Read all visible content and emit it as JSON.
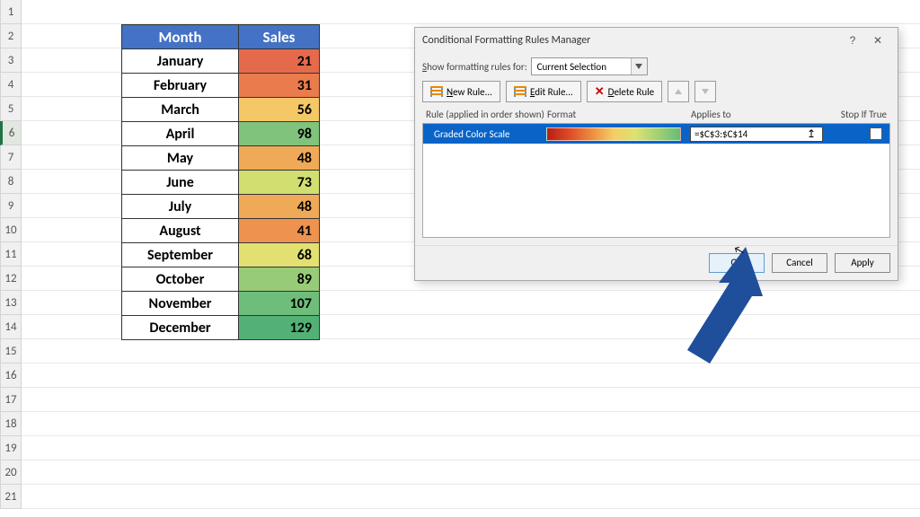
{
  "rows_visible": 21,
  "active_row": 6,
  "table": {
    "headers": {
      "month": "Month",
      "sales": "Sales"
    },
    "data": [
      {
        "month": "January",
        "sales": 21,
        "color": "#e56a4c"
      },
      {
        "month": "February",
        "sales": 31,
        "color": "#ea7b4d"
      },
      {
        "month": "March",
        "sales": 56,
        "color": "#f5c867"
      },
      {
        "month": "April",
        "sales": 98,
        "color": "#7fc37c"
      },
      {
        "month": "May",
        "sales": 48,
        "color": "#f0a956"
      },
      {
        "month": "June",
        "sales": 73,
        "color": "#d2de70"
      },
      {
        "month": "July",
        "sales": 48,
        "color": "#f0a956"
      },
      {
        "month": "August",
        "sales": 41,
        "color": "#ed924f"
      },
      {
        "month": "September",
        "sales": 68,
        "color": "#e3e072"
      },
      {
        "month": "October",
        "sales": 89,
        "color": "#98cb77"
      },
      {
        "month": "November",
        "sales": 107,
        "color": "#6fbd7b"
      },
      {
        "month": "December",
        "sales": 129,
        "color": "#53b176"
      }
    ]
  },
  "dialog": {
    "title": "Conditional Formatting Rules Manager",
    "show_rules_label_pre": "S",
    "show_rules_label_post": "how formatting rules for:",
    "show_rules_value": "Current Selection",
    "buttons": {
      "new_pre": "N",
      "new_post": "ew Rule...",
      "edit_pre": "E",
      "edit_post": "dit Rule...",
      "delete_pre": "D",
      "delete_post": "elete Rule"
    },
    "list_header": {
      "rule": "Rule (applied in order shown)",
      "format": "Format",
      "applies": "Applies to",
      "stop": "Stop If True"
    },
    "rule": {
      "name": "Graded Color Scale",
      "applies_to": "=$C$3:$C$14"
    },
    "footer": {
      "ok": "OK",
      "cancel": "Cancel",
      "apply": "Apply"
    }
  }
}
